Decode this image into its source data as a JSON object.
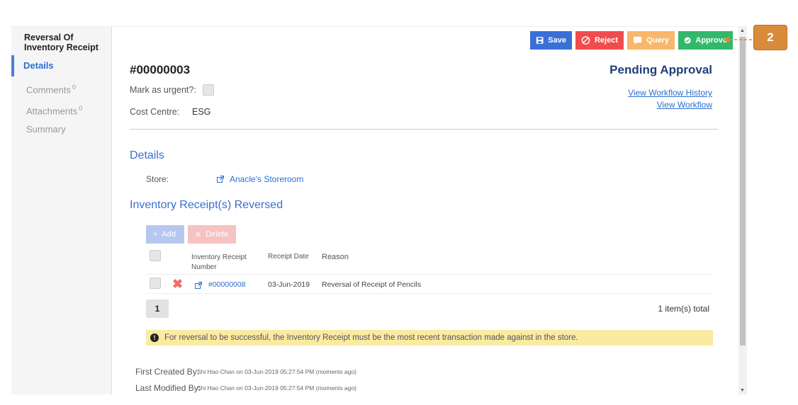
{
  "sidebar": {
    "title_line1": "Reversal Of",
    "title_line2": "Inventory Receipt",
    "items": [
      {
        "label": "Details",
        "sup": ""
      },
      {
        "label": "Comments",
        "sup": "0"
      },
      {
        "label": "Attachments",
        "sup": "0"
      },
      {
        "label": "Summary",
        "sup": ""
      }
    ]
  },
  "toolbar": {
    "save_label": "Save",
    "reject_label": "Reject",
    "query_label": "Query",
    "approve_label": "Approve"
  },
  "header": {
    "doc_number": "#00000003",
    "status": "Pending Approval",
    "view_workflow_history": "View Workflow History",
    "view_workflow": "View Workflow",
    "urgent_label": "Mark as urgent?:",
    "cost_centre_label": "Cost Centre:",
    "cost_centre_value": "ESG"
  },
  "details": {
    "title": "Details",
    "store_label": "Store:",
    "store_value": "Anacle's Storeroom"
  },
  "reversed": {
    "title": "Inventory Receipt(s) Reversed",
    "add_label": "Add",
    "delete_label": "Delete",
    "columns": [
      "Inventory Receipt",
      "Number",
      "Receipt Date",
      "Reason"
    ],
    "rows": [
      {
        "number": "#00000008",
        "date": "03-Jun-2019",
        "reason": "Reversal of Receipt of Pencils"
      }
    ],
    "page": "1",
    "total": "1 item(s) total"
  },
  "notice": "For reversal to be successful, the Inventory Receipt must be the most recent transaction made against in the store.",
  "audit": {
    "created_label": "First Created By:",
    "created_value": "Shi Hao Chan on 03-Jun-2019 05:27:54 PM (moments ago)",
    "modified_label": "Last Modified By:",
    "modified_value": "Shi Hao Chan on 03-Jun-2019 05:27:54 PM (moments ago)"
  },
  "callout": {
    "number": "2",
    "color": "#d98a3a"
  },
  "colors": {
    "save": "#3a6fd8",
    "reject": "#f14c4c",
    "query": "#f8b76a",
    "approve": "#33b86a",
    "link": "#2b6fd1"
  }
}
